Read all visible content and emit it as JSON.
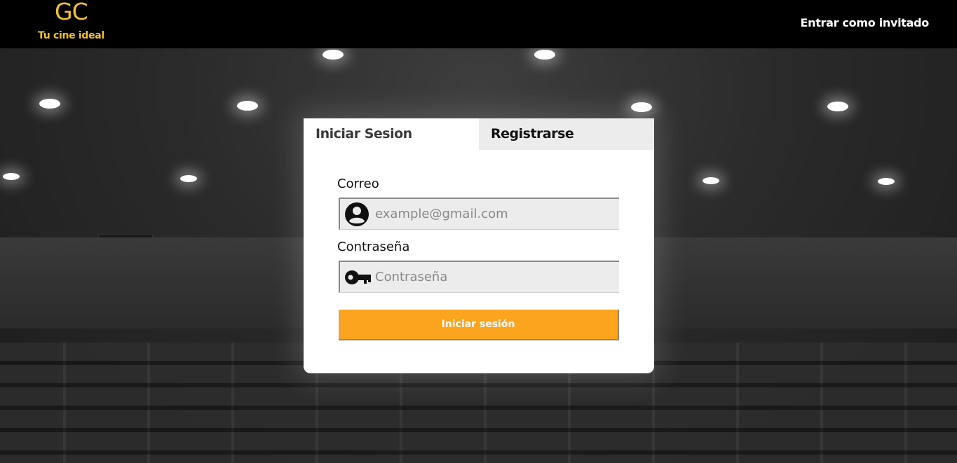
{
  "header": {
    "logo": "GC",
    "tagline": "Tu cine ideal",
    "guest_link": "Entrar como invitado"
  },
  "login": {
    "tabs": [
      {
        "label": "Iniciar Sesion",
        "active": true
      },
      {
        "label": "Registrarse",
        "active": false
      }
    ],
    "email_label": "Correo",
    "email_placeholder": "example@gmail.com",
    "email_icon": "user-circle-icon",
    "password_label": "Contraseña",
    "password_placeholder": "Contraseña",
    "password_icon": "key-icon",
    "submit_label": "Iniciar sesión"
  },
  "colors": {
    "brand_yellow": "#f2c230",
    "button_orange": "#fca41e",
    "header_bg": "#000000"
  }
}
